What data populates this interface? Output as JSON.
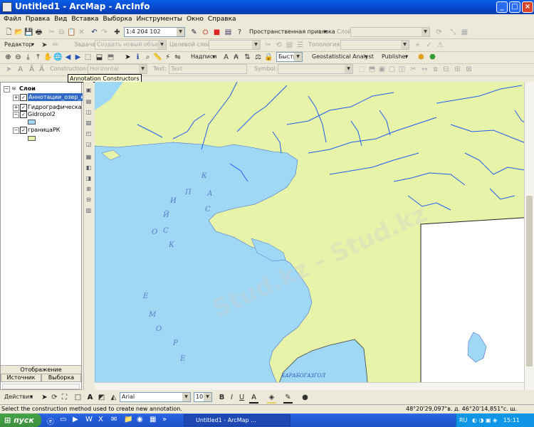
{
  "window": {
    "title": "Untitled1 - ArcMap - ArcInfo",
    "controls": [
      "_",
      "□",
      "×"
    ]
  },
  "menu": [
    "Файл",
    "Правка",
    "Вид",
    "Вставка",
    "Выборка",
    "Инструменты",
    "Окно",
    "Справка"
  ],
  "standard_toolbar": {
    "scale": "1:4 204 102",
    "georef_label": "Пространственная привязка",
    "layer_label": "Слой:"
  },
  "editor_toolbar": {
    "editor_label": "Редактор",
    "task_label": "Задача:",
    "task_value": "Создать новый объект",
    "target_label": "Целевой слой:",
    "topology_label": "Топология:"
  },
  "tools_toolbar": {
    "labels_menu": "Надписи",
    "quick_value": "Быстро",
    "geostat_label": "Geostatistical Analyst",
    "publisher_label": "Publisher"
  },
  "annotation_toolbar": {
    "construction_label": "Construction:",
    "construction_value": "Horizontal",
    "text_label": "Text:",
    "text_value": "Text",
    "symbol_label": "Symbol:"
  },
  "tooltip": "Annotation Constructors",
  "toc": {
    "root": "Слои",
    "layers": [
      {
        "name": "Аннотации_озер_ка",
        "checked": true
      },
      {
        "name": "Гидрографическая с",
        "checked": true
      },
      {
        "name": "Gidropol2",
        "checked": true,
        "legend_color": "#9fd8f5"
      },
      {
        "name": "границаРК",
        "checked": true,
        "legend_color": "#e6f3a8"
      }
    ],
    "tabs": [
      "Отображение",
      "Источник",
      "Выборка"
    ]
  },
  "map": {
    "water_color": "#9fd8f5",
    "land_color": "#e6f3a8",
    "river_color": "#1f5ef0",
    "annotation_color": "#5a78c8",
    "sea_letters": "К А С П И Й С К О Е М О Р Е",
    "gulf_label": "КАРАБОГАЗГОЛ",
    "watermark": "Stud.kz - Stud.kz"
  },
  "draw_toolbar": {
    "actions_label": "Действия",
    "font": "Arial",
    "size": "10",
    "bold": "B",
    "italic": "I",
    "underline": "U"
  },
  "status": {
    "message": "Select the construction method used to create new annotation.",
    "coords": "48°20'29,097\"в. д.  46°20'14,851\"с. ш."
  },
  "taskbar": {
    "start": "пуск",
    "task_button": "Untitled1 - ArcMap ...",
    "lang": "RU",
    "clock": "15:11"
  }
}
